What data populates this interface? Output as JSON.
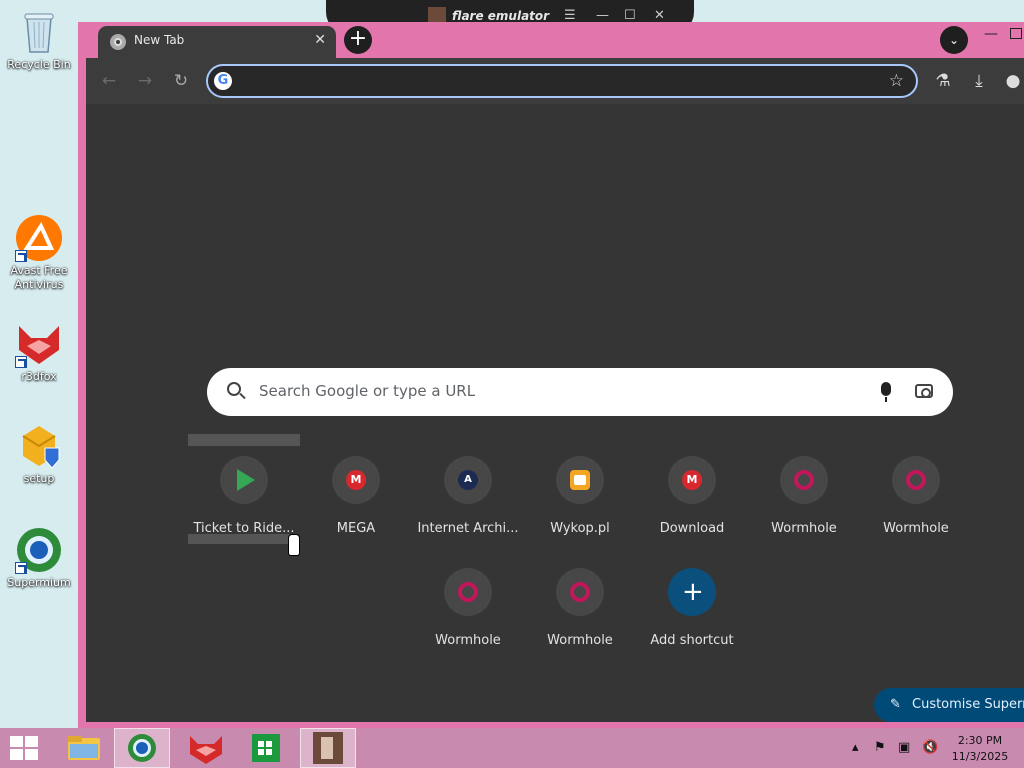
{
  "desktop": {
    "icons": [
      {
        "label": "Recycle Bin"
      },
      {
        "label": "Avast Free Antivirus"
      },
      {
        "label": "r3dfox"
      },
      {
        "label": "setup"
      },
      {
        "label": "Supermium"
      }
    ]
  },
  "flare_window": {
    "title": "flare emulator"
  },
  "browser": {
    "tab_title": "New Tab",
    "omnibox_value": "",
    "search_placeholder": "Search Google or type a URL",
    "shortcuts": [
      {
        "label": "Ticket to Ride...",
        "icon": "play-store-icon"
      },
      {
        "label": "MEGA",
        "icon": "mega-icon",
        "glyph": "M"
      },
      {
        "label": "Internet Archi...",
        "icon": "archive-icon",
        "glyph": "A"
      },
      {
        "label": "Wykop.pl",
        "icon": "wykop-icon"
      },
      {
        "label": "Download",
        "icon": "mega-icon",
        "glyph": "M"
      },
      {
        "label": "Wormhole",
        "icon": "wormhole-icon"
      },
      {
        "label": "Wormhole",
        "icon": "wormhole-icon"
      },
      {
        "label": "Wormhole",
        "icon": "wormhole-icon"
      },
      {
        "label": "Wormhole",
        "icon": "wormhole-icon"
      },
      {
        "label": "Add shortcut",
        "icon": "plus-icon",
        "glyph": "+"
      }
    ],
    "customise_label": "Customise Supermium"
  },
  "taskbar": {
    "time": "2:30 PM",
    "date": "11/3/2025"
  },
  "colors": {
    "window_frame": "#e275ac",
    "ntp_background": "#353535",
    "accent_blue": "#004a77",
    "taskbar": "#c98ab0"
  }
}
